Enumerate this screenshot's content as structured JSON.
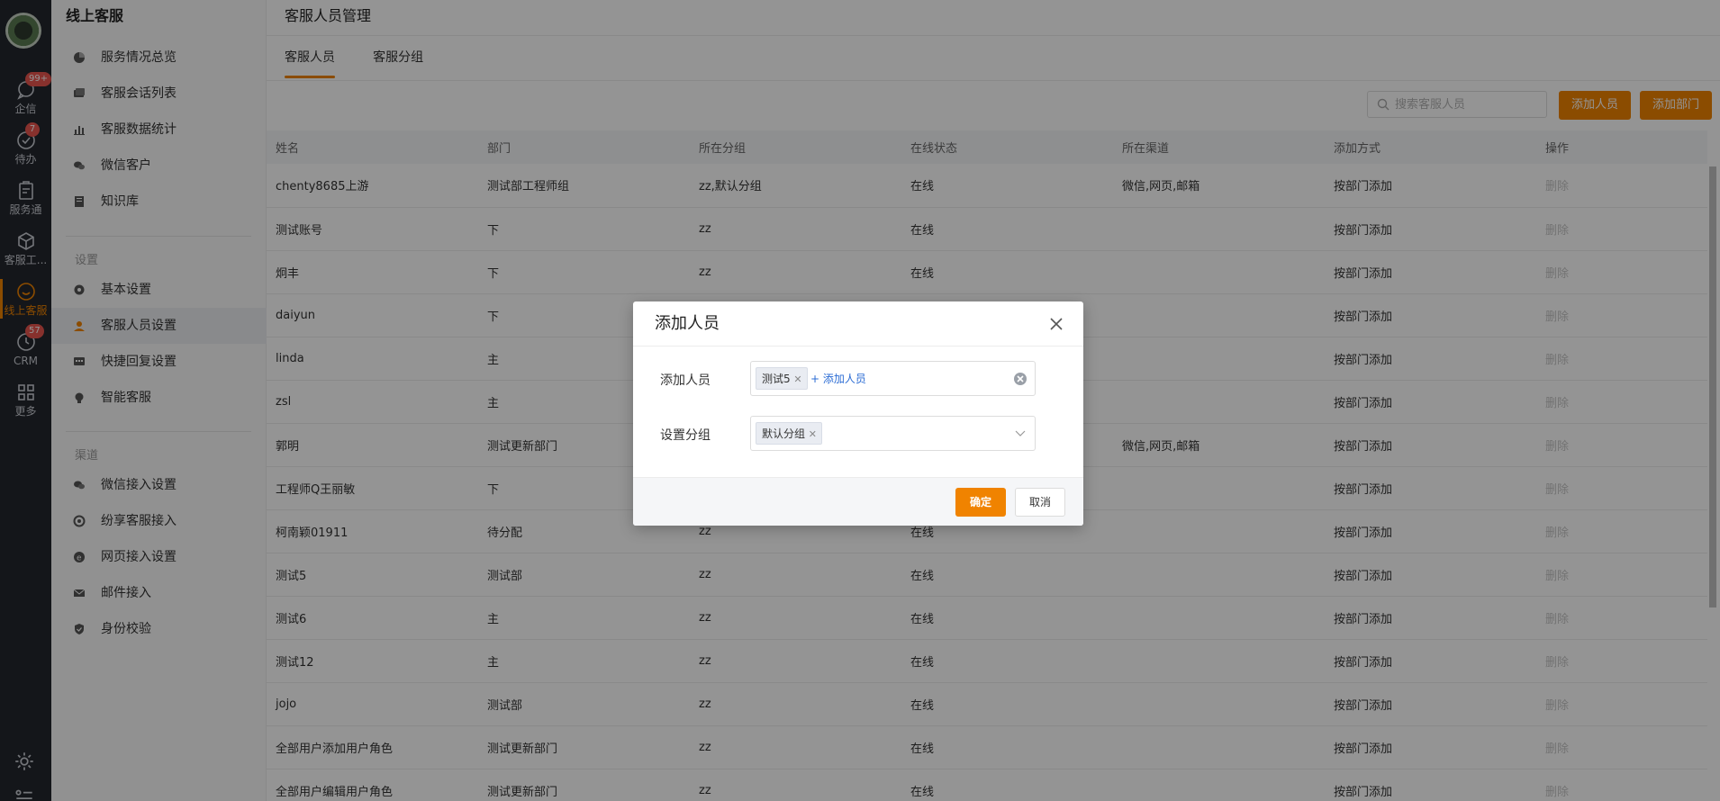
{
  "rail": {
    "items": [
      {
        "label": "企信",
        "badge": "99+",
        "icon": "chat-bubble-icon"
      },
      {
        "label": "待办",
        "badge": "7",
        "icon": "check-circle-icon"
      },
      {
        "label": "服务通",
        "badge": "",
        "icon": "clipboard-icon"
      },
      {
        "label": "客服工...",
        "badge": "",
        "icon": "box-icon"
      },
      {
        "label": "线上客服",
        "badge": "",
        "icon": "smile-icon"
      },
      {
        "label": "CRM",
        "badge": "57",
        "icon": "clock-icon"
      },
      {
        "label": "更多",
        "badge": "",
        "icon": "grid-icon"
      }
    ]
  },
  "sidebar": {
    "title": "线上客服",
    "main_items": [
      {
        "label": "服务情况总览",
        "icon": "pie-chart-icon"
      },
      {
        "label": "客服会话列表",
        "icon": "chat-list-icon"
      },
      {
        "label": "客服数据统计",
        "icon": "bar-chart-icon"
      },
      {
        "label": "微信客户",
        "icon": "wechat-icon"
      },
      {
        "label": "知识库",
        "icon": "book-icon"
      }
    ],
    "settings_group": "设置",
    "settings_items": [
      {
        "label": "基本设置",
        "icon": "gear-icon"
      },
      {
        "label": "客服人员设置",
        "icon": "agent-icon"
      },
      {
        "label": "快捷回复设置",
        "icon": "quick-reply-icon"
      },
      {
        "label": "智能客服",
        "icon": "bulb-icon"
      }
    ],
    "channel_group": "渠道",
    "channel_items": [
      {
        "label": "微信接入设置",
        "icon": "wechat-icon"
      },
      {
        "label": "纷享客服接入",
        "icon": "link-icon"
      },
      {
        "label": "网页接入设置",
        "icon": "web-icon"
      },
      {
        "label": "邮件接入",
        "icon": "mail-icon"
      },
      {
        "label": "身份校验",
        "icon": "shield-icon"
      }
    ]
  },
  "header": {
    "title": "客服人员管理",
    "tabs": [
      "客服人员",
      "客服分组"
    ]
  },
  "toolbar": {
    "search_placeholder": "搜索客服人员",
    "add_person": "添加人员",
    "add_dept": "添加部门"
  },
  "table": {
    "columns": [
      "姓名",
      "部门",
      "所在分组",
      "在线状态",
      "所在渠道",
      "添加方式",
      "操作"
    ],
    "rows": [
      [
        "chenty8685上游",
        "测试部工程师组",
        "zz,默认分组",
        "在线",
        "微信,网页,邮箱",
        "按部门添加",
        "删除"
      ],
      [
        "测试账号",
        "下",
        "zz",
        "在线",
        "",
        "按部门添加",
        "删除"
      ],
      [
        "炯丰",
        "下",
        "zz",
        "在线",
        "",
        "按部门添加",
        "删除"
      ],
      [
        "daiyun",
        "下",
        "",
        "",
        "",
        "按部门添加",
        "删除"
      ],
      [
        "linda",
        "主",
        "",
        "",
        "",
        "按部门添加",
        "删除"
      ],
      [
        "zsl",
        "主",
        "",
        "",
        "",
        "按部门添加",
        "删除"
      ],
      [
        "郭明",
        "测试更新部门",
        "",
        "",
        "微信,网页,邮箱",
        "按部门添加",
        "删除"
      ],
      [
        "工程师Q王丽敏",
        "下",
        "",
        "",
        "",
        "按部门添加",
        "删除"
      ],
      [
        "柯南颖01911",
        "待分配",
        "zz",
        "在线",
        "",
        "按部门添加",
        "删除"
      ],
      [
        "测试5",
        "测试部",
        "zz",
        "在线",
        "",
        "按部门添加",
        "删除"
      ],
      [
        "测试6",
        "主",
        "zz",
        "在线",
        "",
        "按部门添加",
        "删除"
      ],
      [
        "测试12",
        "主",
        "zz",
        "在线",
        "",
        "按部门添加",
        "删除"
      ],
      [
        "jojo",
        "测试部",
        "zz",
        "在线",
        "",
        "按部门添加",
        "删除"
      ],
      [
        "全部用户添加用户角色",
        "测试更新部门",
        "zz",
        "在线",
        "",
        "按部门添加",
        "删除"
      ],
      [
        "全部用户编辑用户角色",
        "测试更新部门",
        "zz",
        "在线",
        "",
        "按部门添加",
        "删除"
      ]
    ]
  },
  "modal": {
    "title": "添加人员",
    "field1_label": "添加人员",
    "field1_tag": "测试5",
    "field1_add": "+ 添加人员",
    "field2_label": "设置分组",
    "field2_tag": "默认分组",
    "ok": "确定",
    "cancel": "取消"
  },
  "colors": {
    "accent": "#f08300",
    "rail_bg": "#24272e",
    "badge": "#e8554e",
    "link": "#2b6cd4"
  }
}
